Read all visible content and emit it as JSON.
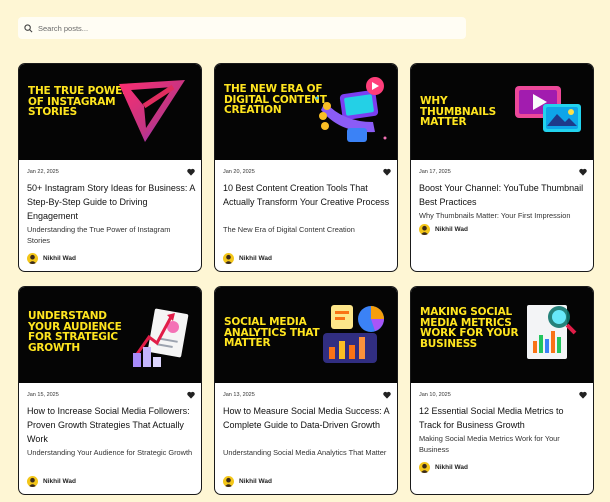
{
  "search": {
    "placeholder": "Search posts..."
  },
  "posts": [
    {
      "thumb_title": "THE TRUE POWER OF INSTAGRAM STORIES",
      "date": "Jan 22, 2025",
      "title": "50+ Instagram Story Ideas for Business: A Step-By-Step Guide to Driving Engagement",
      "subtitle": "Understanding the True Power of Instagram Stories",
      "author": "Nikhil Wad",
      "art_icon": "send-arrow-icon"
    },
    {
      "thumb_title": "THE NEW ERA OF DIGITAL CONTENT CREATION",
      "date": "Jan 20, 2025",
      "title": "10 Best Content Creation Tools That Actually Transform Your Creative Process",
      "subtitle": "The New Era of Digital Content Creation",
      "author": "Nikhil Wad",
      "art_icon": "content-tools-icon"
    },
    {
      "thumb_title": "WHY THUMBNAILS MATTER",
      "date": "Jan 17, 2025",
      "title": "Boost Your Channel: YouTube Thumbnail Best Practices",
      "subtitle": "Why Thumbnails Matter: Your First Impression",
      "author": "Nikhil Wad",
      "art_icon": "video-thumbnail-icon"
    },
    {
      "thumb_title": "UNDERSTAND YOUR AUDIENCE FOR STRATEGIC GROWTH",
      "date": "Jan 15, 2025",
      "title": "How to Increase Social Media Followers: Proven Growth Strategies That Actually Work",
      "subtitle": "Understanding Your Audience for Strategic Growth",
      "author": "Nikhil Wad",
      "art_icon": "growth-chart-icon"
    },
    {
      "thumb_title": "SOCIAL MEDIA ANALYTICS THAT MATTER",
      "date": "Jan 13, 2025",
      "title": "How to Measure Social Media Success: A Complete Guide to Data-Driven Growth",
      "subtitle": "Understanding Social Media Analytics That Matter",
      "author": "Nikhil Wad",
      "art_icon": "analytics-dashboard-icon"
    },
    {
      "thumb_title": "MAKING SOCIAL MEDIA METRICS WORK FOR YOUR BUSINESS",
      "date": "Jan 10, 2025",
      "title": "12 Essential Social Media Metrics to Track for Business Growth",
      "subtitle": "Making Social Media Metrics Work for Your Business",
      "author": "Nikhil Wad",
      "art_icon": "metrics-report-icon"
    }
  ],
  "colors": {
    "background": "#fef6d4",
    "thumb_bg": "#050505",
    "thumb_title": "#ffe51f",
    "avatar": "#f3c619"
  },
  "icons": {
    "search": "search-icon",
    "like": "heart-icon",
    "avatar": "avatar"
  }
}
